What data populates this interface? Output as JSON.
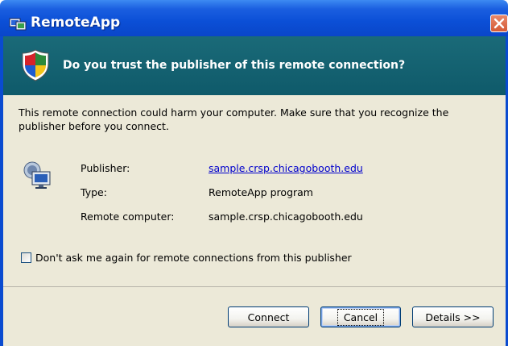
{
  "window": {
    "title": "RemoteApp"
  },
  "header": {
    "question": "Do you trust the publisher of this remote connection?"
  },
  "message": "This remote connection could harm your computer. Make sure that you recognize the publisher before you connect.",
  "details": {
    "publisher_label": "Publisher:",
    "publisher_value": "sample.crsp.chicagobooth.edu",
    "type_label": "Type:",
    "type_value": "RemoteApp program",
    "remote_label": "Remote computer:",
    "remote_value": "sample.crsp.chicagobooth.edu"
  },
  "checkbox": {
    "label": "Don't ask me again for remote connections from this publisher",
    "checked": false
  },
  "buttons": {
    "connect": "Connect",
    "cancel": "Cancel",
    "details": "Details >>"
  },
  "colors": {
    "titlebar": "#0b4fd6",
    "header_band": "#1a6a78",
    "close": "#d55a36",
    "link": "#0000cc"
  },
  "icons": {
    "title": "remoteapp-icon",
    "header": "shield-icon",
    "publisher": "remote-computer-icon",
    "close": "close-icon"
  }
}
